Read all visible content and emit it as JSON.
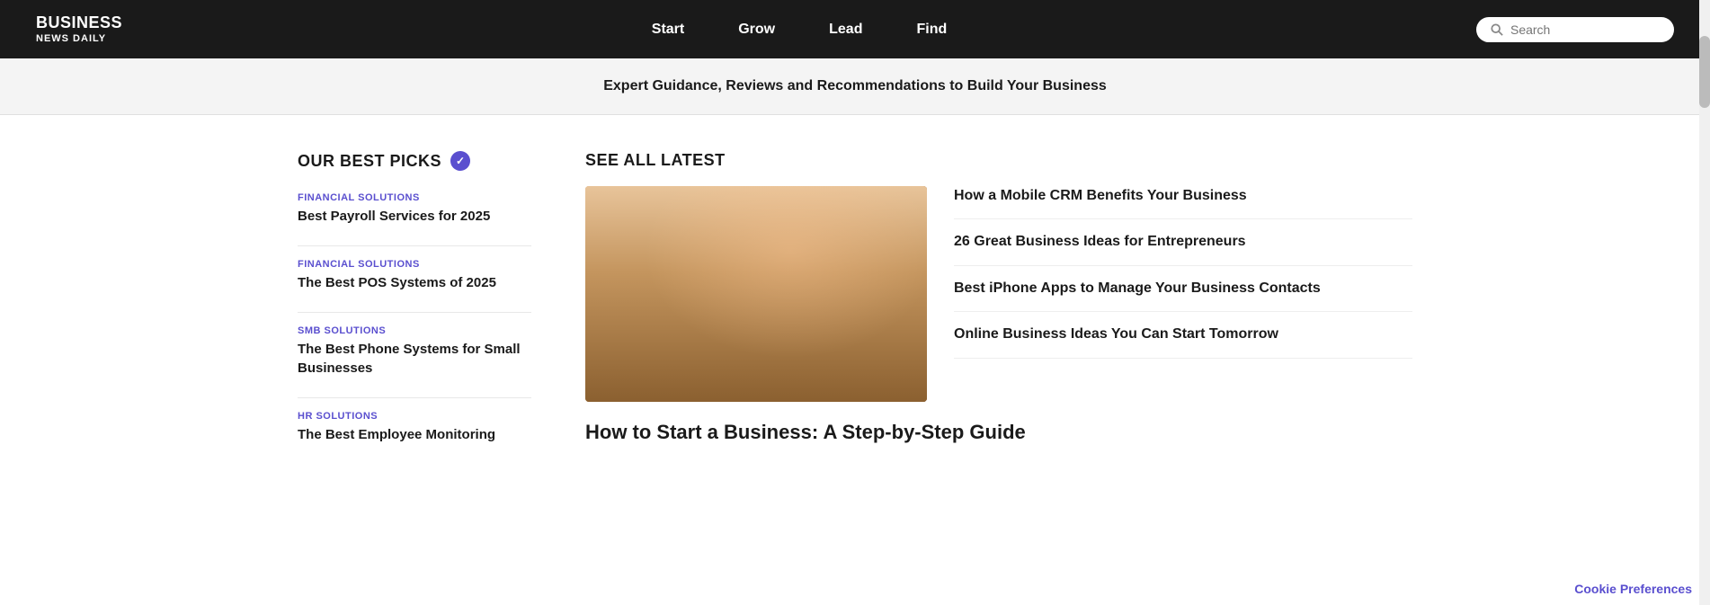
{
  "brand": {
    "line1": "BUSINESS",
    "line2": "NEWS DAILY"
  },
  "nav": {
    "links": [
      {
        "label": "Start",
        "href": "#"
      },
      {
        "label": "Grow",
        "href": "#"
      },
      {
        "label": "Lead",
        "href": "#"
      },
      {
        "label": "Find",
        "href": "#"
      }
    ]
  },
  "search": {
    "placeholder": "Search"
  },
  "tagline": {
    "text": "Expert Guidance, Reviews and Recommendations to Build Your Business"
  },
  "best_picks": {
    "title": "OUR BEST PICKS",
    "items": [
      {
        "category": "FINANCIAL SOLUTIONS",
        "title": "Best Payroll Services for 2025"
      },
      {
        "category": "FINANCIAL SOLUTIONS",
        "title": "The Best POS Systems of 2025"
      },
      {
        "category": "SMB SOLUTIONS",
        "title": "The Best Phone Systems for Small Businesses"
      },
      {
        "category": "HR SOLUTIONS",
        "title": "The Best Employee Monitoring"
      }
    ]
  },
  "latest": {
    "header": "SEE ALL LATEST",
    "articles": [
      {
        "title": "How a Mobile CRM Benefits Your Business"
      },
      {
        "title": "26 Great Business Ideas for Entrepreneurs"
      },
      {
        "title": "Best iPhone Apps to Manage Your Business Contacts"
      },
      {
        "title": "Online Business Ideas You Can Start Tomorrow"
      }
    ],
    "featured": {
      "title": "How to Start a Business: A Step-by-Step Guide"
    }
  },
  "cookie": {
    "label": "Cookie Preferences"
  }
}
